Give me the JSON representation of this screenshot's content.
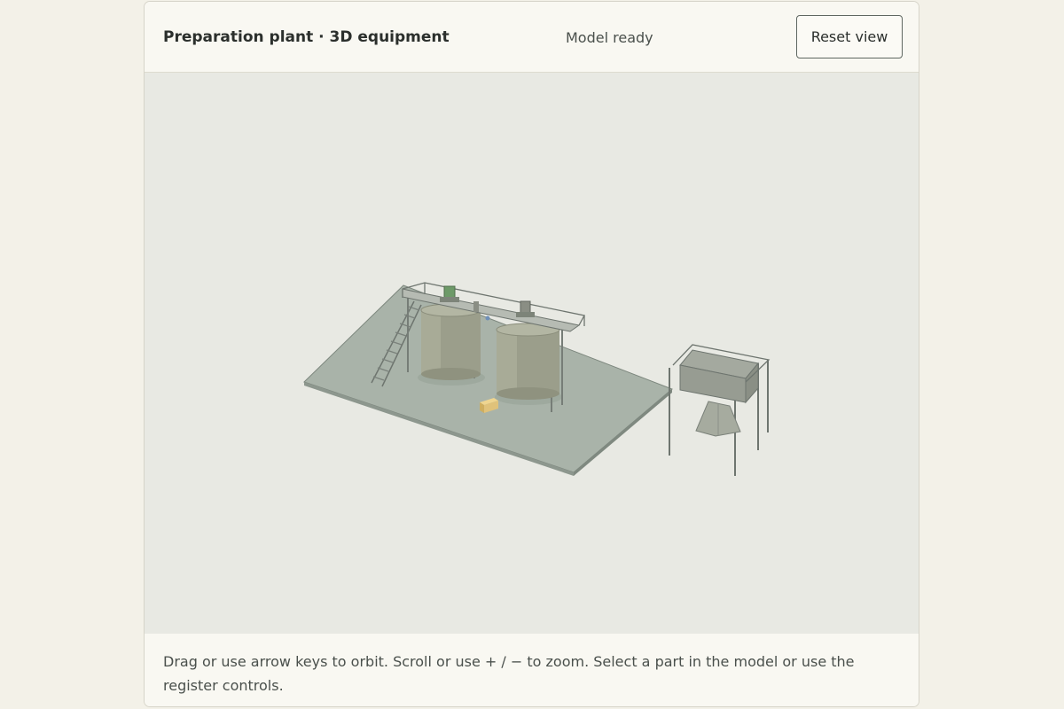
{
  "header": {
    "title": "Preparation plant · 3D equipment",
    "status": "Model ready",
    "reset_label": "Reset view"
  },
  "footer": {
    "hint": "Drag or use arrow keys to orbit. Scroll or use + / − to zoom. Select a part in the model or use the register controls."
  },
  "colors": {
    "panel_bg": "#f9f8f2",
    "viewport_bg": "#e8e9e3",
    "slab": "#a8b2a8",
    "tank": "#9ea18e",
    "structure": "#7f8680",
    "accent_motor": "#6f9a6a",
    "crate": "#e0c27a"
  }
}
